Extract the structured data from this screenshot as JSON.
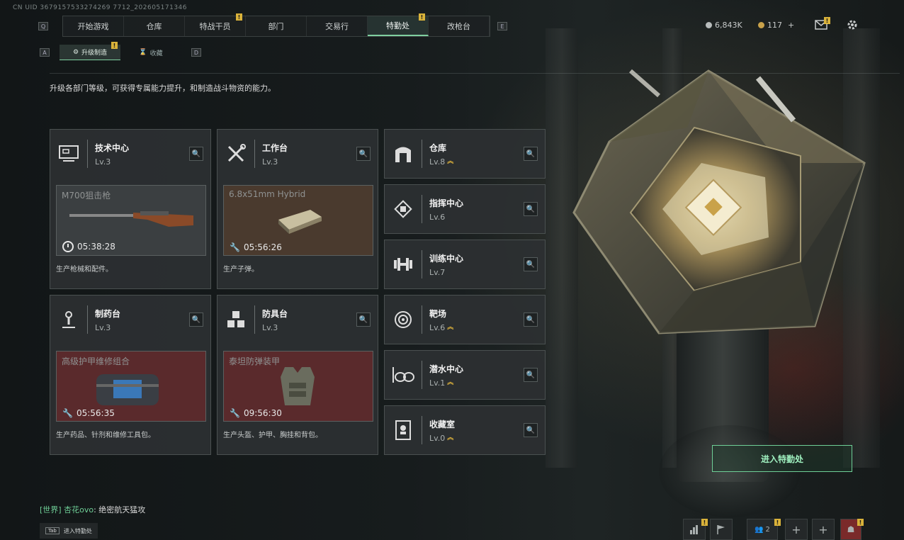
{
  "uid": "CN UID 3679157533274269 7712_202605171346",
  "nav": {
    "left_key": "Q",
    "right_key": "E",
    "items": [
      {
        "label": "开始游戏",
        "active": false,
        "badge": ""
      },
      {
        "label": "仓库",
        "active": false,
        "badge": ""
      },
      {
        "label": "特战干员",
        "active": false,
        "badge": "!"
      },
      {
        "label": "部门",
        "active": false,
        "badge": ""
      },
      {
        "label": "交易行",
        "active": false,
        "badge": ""
      },
      {
        "label": "特勤处",
        "active": true,
        "badge": "!"
      },
      {
        "label": "改枪台",
        "active": false,
        "badge": ""
      }
    ]
  },
  "subnav": {
    "left_key": "A",
    "right_key": "D",
    "items": [
      {
        "label": "升级制造",
        "active": true,
        "badge": "!"
      },
      {
        "label": "收藏",
        "active": false,
        "badge": ""
      }
    ]
  },
  "currency": {
    "money": "6,843K",
    "coupon": "117",
    "add": "+"
  },
  "description": "升级各部门等级，可获得专属能力提升，和制造战斗物资的能力。",
  "production_cards": [
    {
      "title": "技术中心",
      "level": "Lv.3",
      "icon": "computer-icon",
      "product": "M700狙击枪",
      "time": "05:38:28",
      "footer": "生产枪械和配件。",
      "bg": "#3a3e40"
    },
    {
      "title": "工作台",
      "level": "Lv.3",
      "icon": "tools-icon",
      "product": "6.8x51mm Hybrid",
      "time": "05:56:26",
      "footer": "生产子弹。",
      "bg": "#4a3a2e"
    },
    {
      "title": "制药台",
      "level": "Lv.3",
      "icon": "microscope-icon",
      "product": "高级护甲维修组合",
      "time": "05:56:35",
      "footer": "生产药品、针剂和维修工具包。",
      "bg": "#5a2a2c"
    },
    {
      "title": "防具台",
      "level": "Lv.3",
      "icon": "blocks-icon",
      "product": "泰坦防弹装甲",
      "time": "09:56:30",
      "footer": "生产头盔、护甲、胸挂和背包。",
      "bg": "#5a2a2c"
    }
  ],
  "facility_cards": [
    {
      "title": "仓库",
      "level": "Lv.8",
      "icon": "vault-icon",
      "upgrade": true
    },
    {
      "title": "指挥中心",
      "level": "Lv.6",
      "icon": "command-icon",
      "upgrade": false
    },
    {
      "title": "训练中心",
      "level": "Lv.7",
      "icon": "dumbbell-icon",
      "upgrade": false
    },
    {
      "title": "靶场",
      "level": "Lv.6",
      "icon": "target-icon",
      "upgrade": true
    },
    {
      "title": "潜水中心",
      "level": "Lv.1",
      "icon": "goggles-icon",
      "upgrade": true
    },
    {
      "title": "收藏室",
      "level": "Lv.0",
      "icon": "display-case-icon",
      "upgrade": true
    }
  ],
  "enter_button": "进入特勤处",
  "chat": {
    "channel": "[世界]",
    "name": "杏花ovo",
    "message": ": 绝密航天猛攻"
  },
  "tab_hint": {
    "key": "Tab",
    "label": "进入特勤处"
  },
  "bottom_bar": {
    "friends_count": "2"
  }
}
